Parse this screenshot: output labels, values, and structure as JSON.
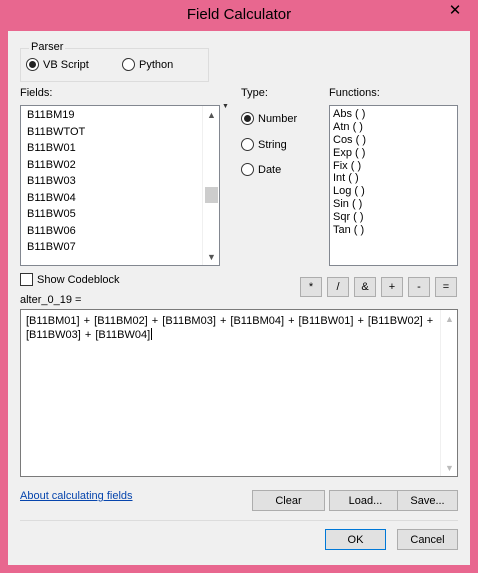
{
  "window": {
    "title": "Field Calculator",
    "close_glyph": "✕"
  },
  "parser": {
    "legend": "Parser",
    "options": [
      {
        "label": "VB Script",
        "checked": true
      },
      {
        "label": "Python",
        "checked": false
      }
    ]
  },
  "fields": {
    "label": "Fields:",
    "items": [
      "B11BM19",
      "B11BWTOT",
      "B11BW01",
      "B11BW02",
      "B11BW03",
      "B11BW04",
      "B11BW05",
      "B11BW06",
      "B11BW07"
    ]
  },
  "type": {
    "label": "Type:",
    "options": [
      {
        "label": "Number",
        "checked": true
      },
      {
        "label": "String",
        "checked": false
      },
      {
        "label": "Date",
        "checked": false
      }
    ]
  },
  "functions": {
    "label": "Functions:",
    "items": [
      "Abs ( )",
      "Atn ( )",
      "Cos ( )",
      "Exp ( )",
      "Fix ( )",
      "Int ( )",
      "Log ( )",
      "Sin ( )",
      "Sqr ( )",
      "Tan ( )"
    ]
  },
  "show_codeblock": {
    "label": "Show Codeblock",
    "checked": false
  },
  "operators": [
    "*",
    "/",
    "&",
    "+",
    "-",
    "="
  ],
  "expression": {
    "target_label": "alter_0_19 =",
    "text": "[B11BM01] + [B11BM02] + [B11BM03] + [B11BM04] + [B11BW01] + [B11BW02] +\n[B11BW03] + [B11BW04]"
  },
  "help_link": "About calculating fields",
  "buttons": {
    "clear": "Clear",
    "load": "Load...",
    "save": "Save...",
    "ok": "OK",
    "cancel": "Cancel"
  },
  "scroll_arrows": {
    "up": "▲",
    "down": "▼",
    "menu": "▼"
  }
}
